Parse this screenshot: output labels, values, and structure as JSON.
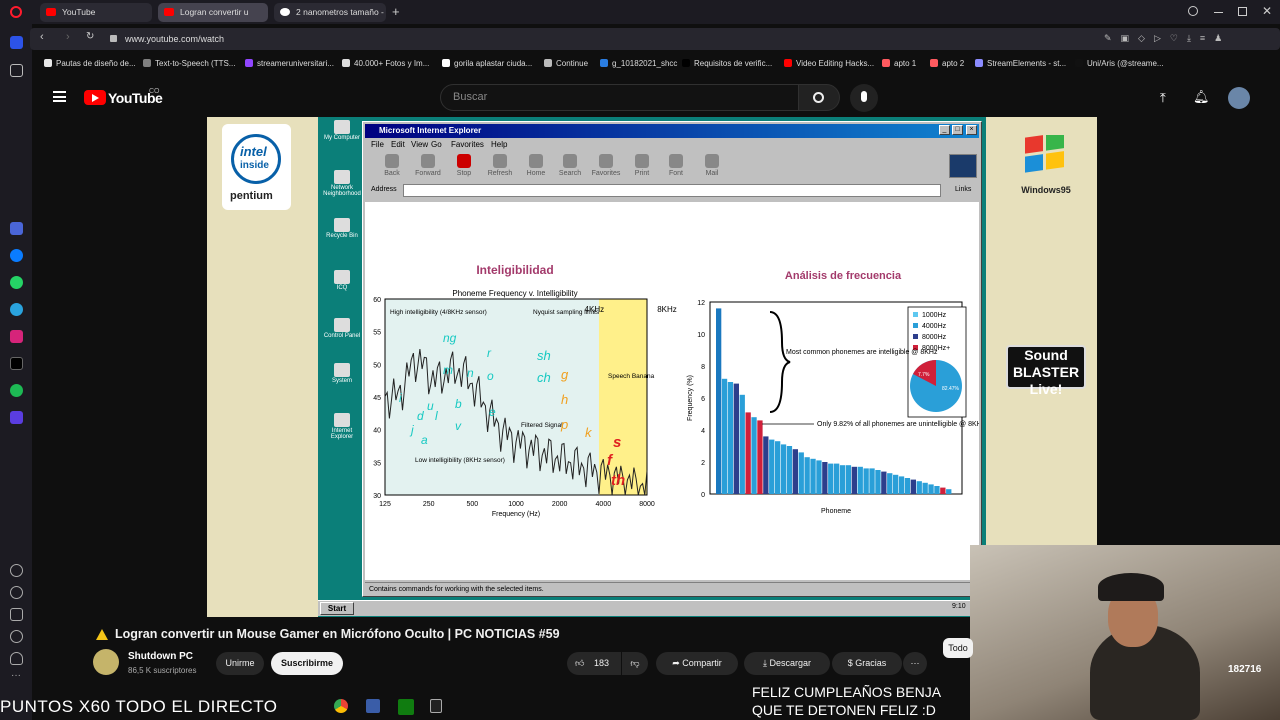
{
  "browser": {
    "tabs": [
      {
        "label": "YouTube"
      },
      {
        "label": "Logran convertir u"
      },
      {
        "label": "2 nanometros tamaño - B"
      }
    ],
    "url": "www.youtube.com/watch",
    "bookmarks": [
      {
        "label": "Pautas de diseño de...",
        "color": "#e8e8e8"
      },
      {
        "label": "Text-to-Speech (TTS...",
        "color": "#7f7f7f"
      },
      {
        "label": "streameruniversitari...",
        "color": "#9146ff"
      },
      {
        "label": "40.000+ Fotos y Im...",
        "color": "#dddddd"
      },
      {
        "label": "gorila aplastar ciuda...",
        "color": "#ffffff"
      },
      {
        "label": "Continue",
        "color": "#bbbbbb"
      },
      {
        "label": "g_10182021_shcc",
        "color": "#2a7de1"
      },
      {
        "label": "Requisitos de verific...",
        "color": "#000000"
      },
      {
        "label": "Video Editing Hacks...",
        "color": "#ff0000"
      },
      {
        "label": "apto 1",
        "color": "#ff5a5f"
      },
      {
        "label": "apto 2",
        "color": "#ff5a5f"
      },
      {
        "label": "StreamElements - st...",
        "color": "#8c8cff"
      },
      {
        "label": "Uni/Aris (@streame...",
        "color": "#111111"
      }
    ]
  },
  "youtube": {
    "logo_text": "YouTube",
    "country": "CO",
    "search_placeholder": "Buscar",
    "video_title": "Logran convertir un Mouse Gamer en Micrófono Oculto | PC NOTICIAS #59",
    "channel_name": "Shutdown PC",
    "subscribers": "86,5 K suscriptores",
    "join_label": "Unirme",
    "subscribe_label": "Suscribirme",
    "likes": "183",
    "share_label": "Compartir",
    "download_label": "Descargar",
    "thanks_label": "Gracias",
    "more_label": "Todo"
  },
  "video": {
    "intel_lines": [
      "intel",
      "inside",
      "pentium"
    ],
    "win95_text": "Windows95",
    "soundblaster": "Sound BLASTER Live!",
    "ie_title": "Microsoft Internet Explorer",
    "menus": [
      "File",
      "Edit",
      "View",
      "Go",
      "Favorites",
      "Help"
    ],
    "toolbar": [
      "Back",
      "Forward",
      "Stop",
      "Refresh",
      "Home",
      "Search",
      "Favorites",
      "Print",
      "Font",
      "Mail"
    ],
    "address_label": "Address",
    "links_label": "Links",
    "status_text": "Contains commands for working with the selected items.",
    "start_label": "Start",
    "clock": "9:10",
    "desktop_icons": [
      "My Computer",
      "Network Neighborhood",
      "Recycle Bin",
      "ICQ",
      "Control Panel",
      "System",
      "Internet Explorer"
    ]
  },
  "chart_data": [
    {
      "type": "area",
      "title": "Inteligibilidad",
      "subtitle": "Phoneme Frequency v. Intelligibility",
      "xlabel": "Frequency (Hz)",
      "x_ticks": [
        "125",
        "250",
        "500",
        "1000",
        "2000",
        "4000",
        "8000"
      ],
      "y_ticks": [
        30,
        35,
        40,
        45,
        50,
        55,
        60
      ],
      "ylim": [
        30,
        60
      ],
      "bands": [
        "4KHz",
        "8KHz"
      ],
      "annotations": [
        "High intelligibility (4/8KHz sensor)",
        "Nyquist sampling limits",
        "Speech Banana",
        "Filtered Signal",
        "Low intelligibility (8KHz sensor)"
      ],
      "phonemes_low": [
        "ng",
        "r",
        "m",
        "n",
        "o",
        "i",
        "u",
        "b",
        "e",
        "d",
        "l",
        "j",
        "v",
        "a"
      ],
      "phonemes_mid": [
        "sh",
        "ch",
        "g",
        "h",
        "p",
        "k"
      ],
      "phonemes_high": [
        "s",
        "f",
        "th"
      ]
    },
    {
      "type": "bar",
      "title": "Análisis de frecuencia",
      "xlabel": "Phoneme",
      "ylabel": "Frequency (%)",
      "ylim": [
        0,
        12
      ],
      "y_ticks": [
        0,
        2,
        4,
        6,
        8,
        10,
        12
      ],
      "values": [
        11.6,
        7.2,
        7.0,
        6.9,
        6.2,
        5.1,
        4.8,
        4.6,
        3.6,
        3.4,
        3.3,
        3.1,
        3.0,
        2.8,
        2.6,
        2.3,
        2.2,
        2.1,
        2.0,
        1.9,
        1.9,
        1.8,
        1.8,
        1.7,
        1.7,
        1.6,
        1.6,
        1.5,
        1.4,
        1.3,
        1.2,
        1.1,
        1.0,
        0.9,
        0.8,
        0.7,
        0.6,
        0.5,
        0.4,
        0.3
      ],
      "legend": [
        "1000Hz",
        "4000Hz",
        "8000Hz",
        "8000Hz+"
      ],
      "annotations": [
        "Most common phonemes are intelligible @ 8KHz",
        "Only 9.82% of all phonemes are unintelligible @ 8KHz"
      ],
      "pie_labels": [
        "82.47%",
        "7.7%"
      ]
    }
  ],
  "stream": {
    "overlay_left": "PUNTOS X60 TODO EL DIRECTO",
    "overlay_line1": "FELIZ CUMPLEAÑOS BENJA",
    "overlay_line2": "QUE TE DETONEN FELIZ :D",
    "counter": "182716"
  }
}
